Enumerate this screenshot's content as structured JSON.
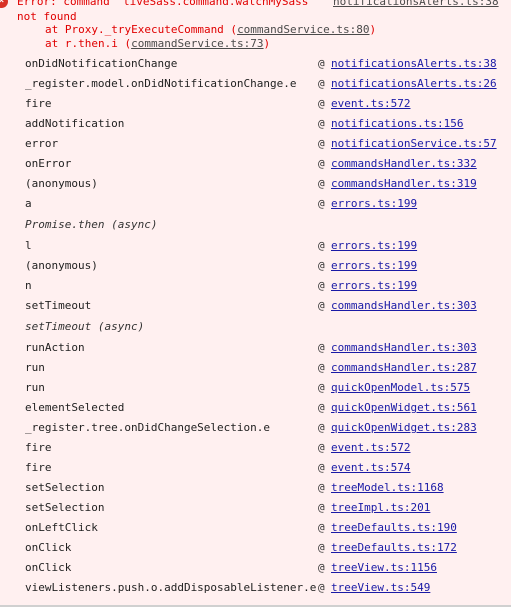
{
  "error": {
    "line1": "Error: command 'liveSass.command.watchMySass'",
    "line1_link": "notificationsAlerts.ts:38",
    "line2": "not found",
    "line3_prefix": "at Proxy._tryExecuteCommand (",
    "line3_link": "commandService.ts:80",
    "line3_suffix": ")",
    "line4_prefix": "at r.then.i (",
    "line4_link": "commandService.ts:73",
    "line4_suffix": ")",
    "icon_glyph": "×"
  },
  "frames": [
    {
      "fn": "onDidNotificationChange",
      "at": "@",
      "src": "notificationsAlerts.ts:38"
    },
    {
      "fn": "_register.model.onDidNotificationChange.e",
      "at": "@",
      "src": "notificationsAlerts.ts:26"
    },
    {
      "fn": "fire",
      "at": "@",
      "src": "event.ts:572"
    },
    {
      "fn": "addNotification",
      "at": "@",
      "src": "notifications.ts:156"
    },
    {
      "fn": "error",
      "at": "@",
      "src": "notificationService.ts:57"
    },
    {
      "fn": "onError",
      "at": "@",
      "src": "commandsHandler.ts:332"
    },
    {
      "fn": "(anonymous)",
      "at": "@",
      "src": "commandsHandler.ts:319"
    },
    {
      "fn": "a",
      "at": "@",
      "src": "errors.ts:199"
    },
    {
      "fn": "Promise.then (async)",
      "async": true
    },
    {
      "fn": "l",
      "at": "@",
      "src": "errors.ts:199"
    },
    {
      "fn": "(anonymous)",
      "at": "@",
      "src": "errors.ts:199"
    },
    {
      "fn": "n",
      "at": "@",
      "src": "errors.ts:199"
    },
    {
      "fn": "setTimeout",
      "at": "@",
      "src": "commandsHandler.ts:303"
    },
    {
      "fn": "setTimeout (async)",
      "async": true
    },
    {
      "fn": "runAction",
      "at": "@",
      "src": "commandsHandler.ts:303"
    },
    {
      "fn": "run",
      "at": "@",
      "src": "commandsHandler.ts:287"
    },
    {
      "fn": "run",
      "at": "@",
      "src": "quickOpenModel.ts:575"
    },
    {
      "fn": "elementSelected",
      "at": "@",
      "src": "quickOpenWidget.ts:561"
    },
    {
      "fn": "_register.tree.onDidChangeSelection.e",
      "at": "@",
      "src": "quickOpenWidget.ts:283"
    },
    {
      "fn": "fire",
      "at": "@",
      "src": "event.ts:572"
    },
    {
      "fn": "fire",
      "at": "@",
      "src": "event.ts:574"
    },
    {
      "fn": "setSelection",
      "at": "@",
      "src": "treeModel.ts:1168"
    },
    {
      "fn": "setSelection",
      "at": "@",
      "src": "treeImpl.ts:201"
    },
    {
      "fn": "onLeftClick",
      "at": "@",
      "src": "treeDefaults.ts:190"
    },
    {
      "fn": "onClick",
      "at": "@",
      "src": "treeDefaults.ts:172"
    },
    {
      "fn": "onClick",
      "at": "@",
      "src": "treeView.ts:1156"
    },
    {
      "fn": "viewListeners.push.o.addDisposableListener.e",
      "at": "@",
      "src": "treeView.ts:549"
    }
  ]
}
